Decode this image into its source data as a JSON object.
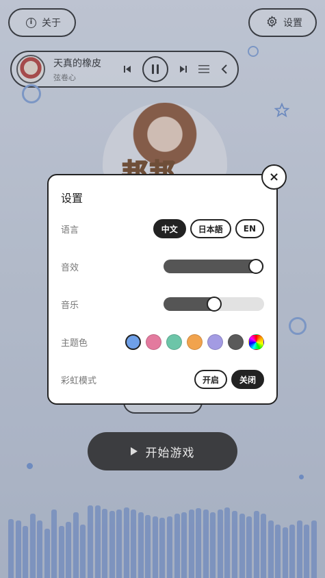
{
  "top": {
    "about_label": "关于",
    "settings_label": "设置"
  },
  "player": {
    "title": "天真的橡皮",
    "artist": "弦卷心"
  },
  "start_button": {
    "label": "开始游戏"
  },
  "settings": {
    "title": "设置",
    "close_label": "×",
    "language": {
      "label": "语言",
      "options": [
        "中文",
        "日本語",
        "EN"
      ],
      "selected": "中文"
    },
    "sound_effects": {
      "label": "音效",
      "level": 0.92
    },
    "music": {
      "label": "音乐",
      "level": 0.5
    },
    "theme_color": {
      "label": "主题色",
      "colors": [
        "#6fa0e8",
        "#e37a9e",
        "#6cc5a8",
        "#f1a34d",
        "#a39be3",
        "#5a5a5a",
        "rainbow"
      ],
      "selected": "#6fa0e8"
    },
    "rainbow_mode": {
      "label": "彩虹模式",
      "on_label": "开启",
      "off_label": "关闭",
      "selected": "关闭"
    }
  },
  "visualizer": {
    "levels": [
      0.72,
      0.7,
      0.63,
      0.78,
      0.7,
      0.6,
      0.83,
      0.63,
      0.68,
      0.8,
      0.65,
      0.88,
      0.88,
      0.84,
      0.82,
      0.83,
      0.86,
      0.83,
      0.8,
      0.77,
      0.75,
      0.73,
      0.75,
      0.78,
      0.8,
      0.83,
      0.85,
      0.83,
      0.8,
      0.83,
      0.86,
      0.82,
      0.78,
      0.75,
      0.82,
      0.78,
      0.7,
      0.65,
      0.62,
      0.65,
      0.7,
      0.65,
      0.7
    ]
  }
}
